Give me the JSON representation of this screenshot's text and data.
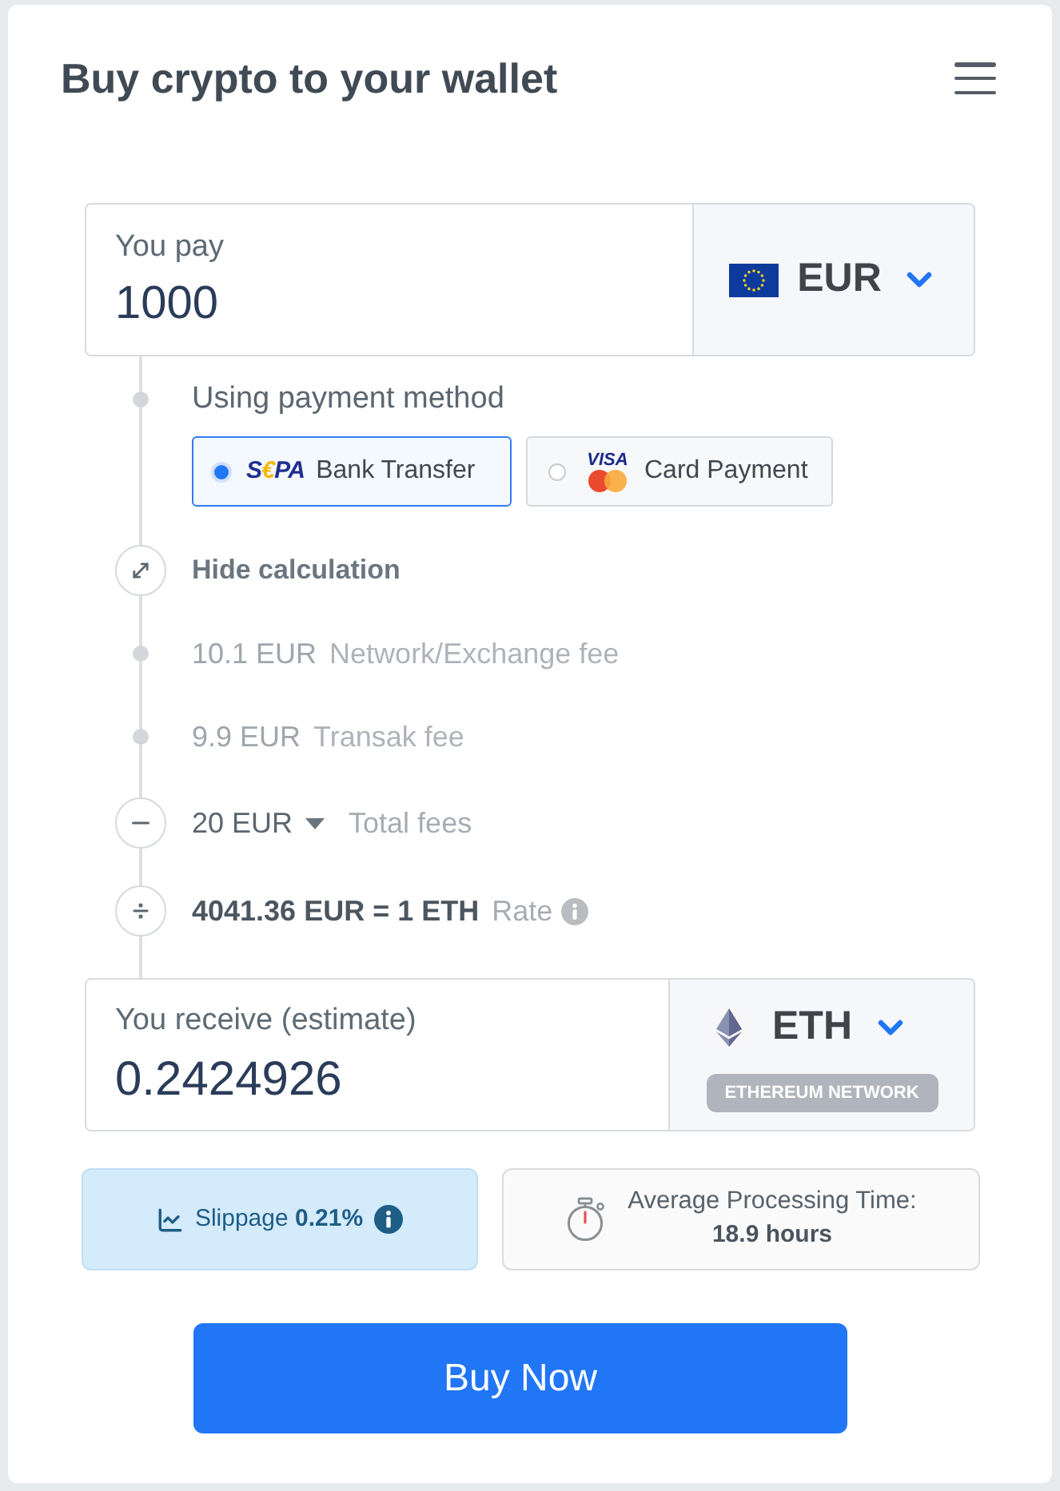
{
  "header": {
    "title": "Buy crypto to your wallet"
  },
  "pay": {
    "label": "You pay",
    "value": "1000",
    "currency": "EUR"
  },
  "payment_method": {
    "label": "Using payment method",
    "options": [
      {
        "kind": "sepa",
        "logo": "S€PA",
        "label": "Bank Transfer",
        "selected": true
      },
      {
        "kind": "card",
        "logo": "VISA",
        "label": "Card Payment",
        "selected": false
      }
    ]
  },
  "calculation": {
    "toggle": "Hide calculation",
    "rows": [
      {
        "kind": "fee",
        "amount": "10.1 EUR",
        "label": "Network/Exchange fee"
      },
      {
        "kind": "fee",
        "amount": "9.9 EUR",
        "label": "Transak fee"
      },
      {
        "kind": "total",
        "amount": "20 EUR",
        "label": "Total fees"
      },
      {
        "kind": "rate",
        "amount": "4041.36 EUR = 1 ETH",
        "label": "Rate"
      }
    ]
  },
  "receive": {
    "label": "You receive (estimate)",
    "value": "0.2424926",
    "currency": "ETH",
    "network": "ETHEREUM NETWORK"
  },
  "slippage": {
    "text": "Slippage **0.21%**"
  },
  "processing": {
    "label": "Average Processing Time:",
    "value": "18.9 hours"
  },
  "buy_button": {
    "label": "Buy Now"
  }
}
